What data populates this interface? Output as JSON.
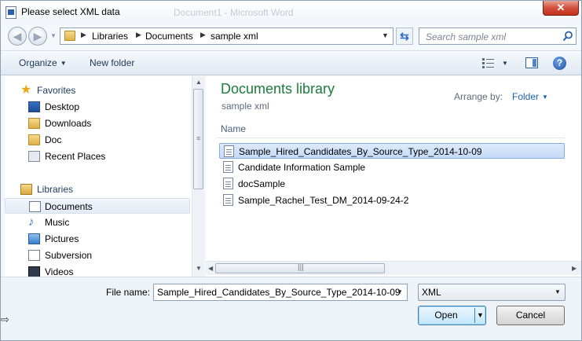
{
  "window": {
    "title": "Please select XML data",
    "background_title": "Document1 - Microsoft Word",
    "close_label": "✕"
  },
  "address": {
    "parts": [
      "Libraries",
      "Documents",
      "sample xml"
    ],
    "search_placeholder": "Search sample xml"
  },
  "toolbar": {
    "organize_label": "Organize",
    "new_folder_label": "New folder"
  },
  "nav": {
    "items": [
      {
        "label": "Favorites",
        "icon": "star-icon"
      },
      {
        "label": "Desktop",
        "icon": "desktop-icon"
      },
      {
        "label": "Downloads",
        "icon": "downloads-folder-icon"
      },
      {
        "label": "Doc",
        "icon": "folder-icon"
      },
      {
        "label": "Recent Places",
        "icon": "recent-places-icon"
      },
      {
        "label": "Libraries",
        "icon": "libraries-icon"
      },
      {
        "label": "Documents",
        "icon": "documents-icon",
        "selected": true
      },
      {
        "label": "Music",
        "icon": "music-icon"
      },
      {
        "label": "Pictures",
        "icon": "pictures-icon"
      },
      {
        "label": "Subversion",
        "icon": "document-icon"
      },
      {
        "label": "Videos",
        "icon": "videos-icon"
      }
    ]
  },
  "content": {
    "title": "Documents library",
    "subtitle": "sample xml",
    "arrange_by_label": "Arrange by:",
    "arrange_by_value": "Folder",
    "column_name": "Name",
    "files": [
      {
        "name": "Sample_Hired_Candidates_By_Source_Type_2014-10-09",
        "selected": true
      },
      {
        "name": "Candidate Information Sample",
        "selected": false
      },
      {
        "name": "docSample",
        "selected": false
      },
      {
        "name": "Sample_Rachel_Test_DM_2014-09-24-2",
        "selected": false
      }
    ]
  },
  "footer": {
    "file_name_label": "File name:",
    "file_name_value": "Sample_Hired_Candidates_By_Source_Type_2014-10-09",
    "file_type_value": "XML",
    "open_label": "Open",
    "cancel_label": "Cancel"
  },
  "colors": {
    "library_title": "#1e7a3c",
    "selection": "#c4daf7",
    "link": "#1e5fb0"
  }
}
